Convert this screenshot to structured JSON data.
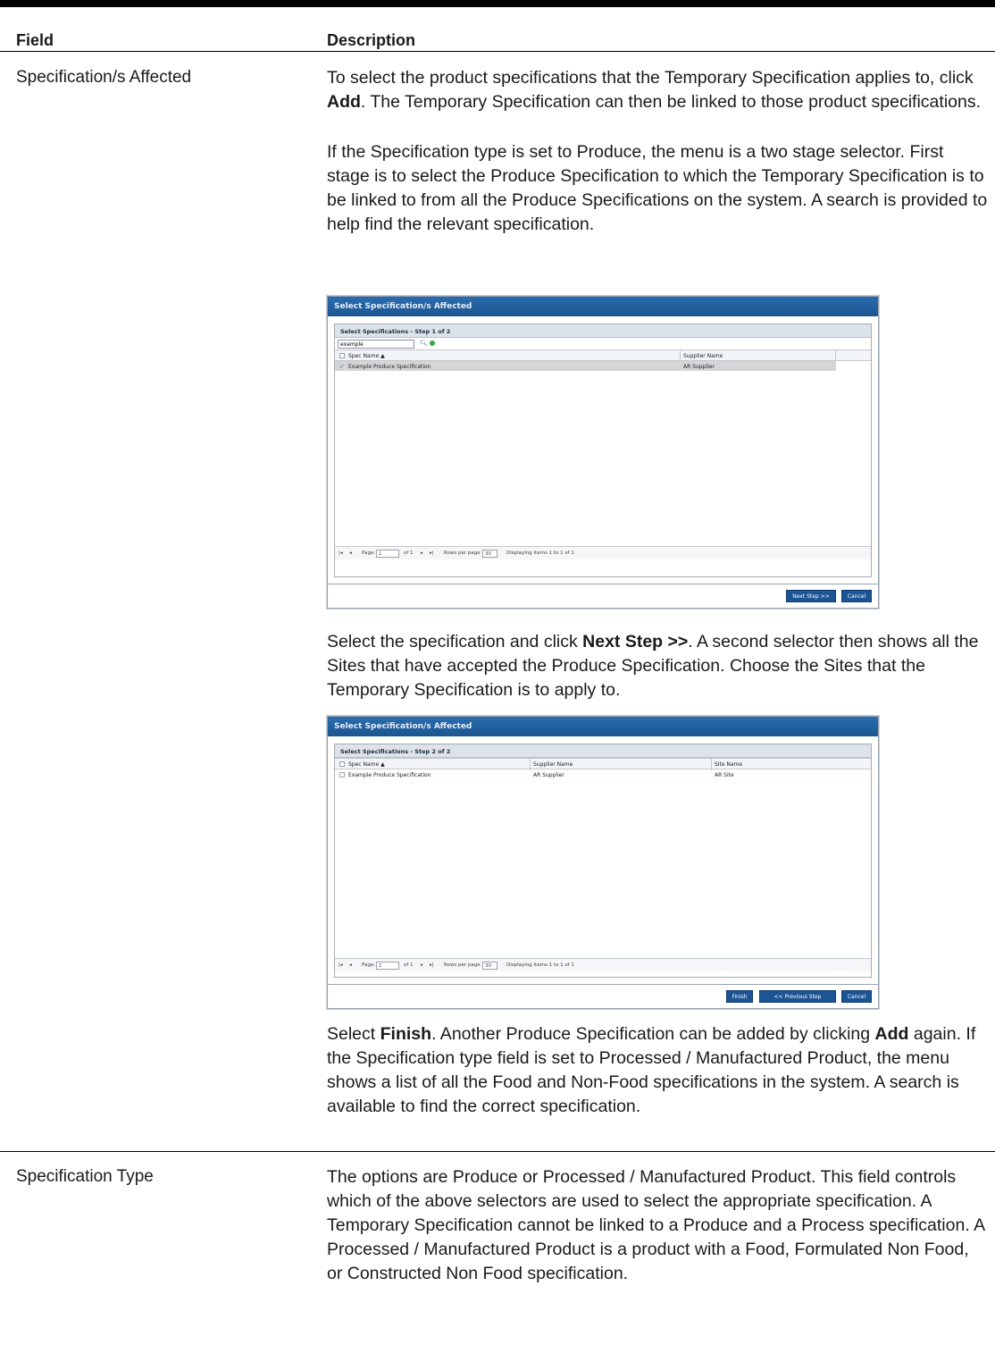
{
  "header": {
    "field": "Field",
    "description": "Description"
  },
  "rows": [
    {
      "field": "Specification/s Affected"
    },
    {
      "field": "Specification Type"
    }
  ],
  "text": {
    "p1_a": "To select the product specifications that the Temporary Specification applies to, click ",
    "p1_b": "Add",
    "p1_c": ". The Temporary Specification can then be linked to those product specifications.",
    "p2": "If the Specification type is set to Produce, the menu is a two stage selector. First stage is to select the Produce Specification to which the Temporary Specification is to be linked to from all the Produce Specifications on the system. A search is provided to help find the relevant specification.",
    "p3_a": "Select the specification and click ",
    "p3_b": "Next Step >>",
    "p3_c": ". A second selector then shows all the Sites that have accepted the Produce Specification. Choose the Sites that the Temporary Specification is to apply to.",
    "p4_a": "Select ",
    "p4_b": "Finish",
    "p4_c": ". Another Produce Specification can be added by clicking ",
    "p4_d": "Add",
    "p4_e": " again. If the Specification type field is set to Processed / Manufactured Product, the menu shows a list of all the Food and Non-Food specifications in the system. A search is available to find the correct specification.",
    "p5": "The options are Produce or Processed / Manufactured Product. This field controls which of the above selectors are used to select the appropriate specification. A Temporary Specification cannot be linked to a Produce and a Process specification. A Processed / Manufactured Product is a product with a Food, Formulated Non Food, or Constructed Non Food specification."
  },
  "dialog1": {
    "title": "Select Specification/s Affected",
    "step": "Select Specifications - Step 1 of 2",
    "search_value": "example",
    "col_spec": "Spec Name ▲",
    "col_supplier": "Supplier Name",
    "row_spec": "Example Produce Specification",
    "row_supplier": "AR Supplier",
    "page_label": "Page:",
    "page_value": "1",
    "of_pages": "of 1",
    "rows_per_page_label": "Rows per page",
    "rows_per_page_value": "30",
    "displaying": "Displaying items 1 to 1 of 1",
    "btn_next": "Next Step >>",
    "btn_cancel": "Cancel"
  },
  "dialog2": {
    "title": "Select Specification/s Affected",
    "step": "Select Specifications - Step 2 of 2",
    "col_spec": "Spec Name ▲",
    "col_supplier": "Supplier Name",
    "col_site": "Site Name",
    "row_spec": "Example Produce Specification",
    "row_supplier": "AR Supplier",
    "row_site": "AR Site",
    "page_label": "Page:",
    "page_value": "1",
    "of_pages": "of 1",
    "rows_per_page_label": "Rows per page",
    "rows_per_page_value": "30",
    "displaying": "Displaying items 1 to 1 of 1",
    "btn_finish": "Finish",
    "btn_previous": "<< Previous Step",
    "btn_cancel": "Cancel"
  }
}
